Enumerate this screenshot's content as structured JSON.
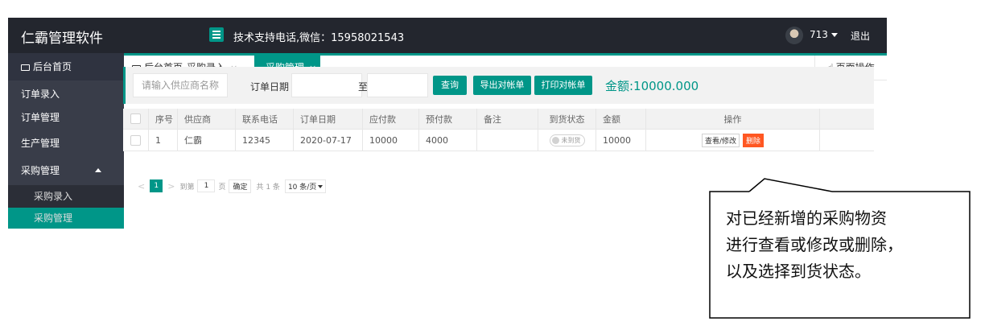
{
  "header": {
    "brand": "仁霸管理软件",
    "support": "技术支持电话,微信：15958021543",
    "user": "713",
    "logout": "退出"
  },
  "sidebar": {
    "items": [
      {
        "label": "后台首页"
      },
      {
        "label": "订单录入"
      },
      {
        "label": "订单管理"
      },
      {
        "label": "生产管理"
      },
      {
        "label": "采购管理"
      },
      {
        "label": "采购录入"
      },
      {
        "label": "采购管理"
      }
    ]
  },
  "tabs": {
    "home": "后台首页",
    "entry": "采购录入",
    "mgmt": "采购管理",
    "close": "×",
    "page_ops": "页面操作"
  },
  "filter": {
    "supplier_placeholder": "请输入供应商名称",
    "date_label": "订单日期",
    "to": "至",
    "query": "查询",
    "export": "导出对帐单",
    "print": "打印对帐单",
    "amount": "金额:10000.000"
  },
  "table": {
    "headers": [
      "序号",
      "供应商",
      "联系电话",
      "订单日期",
      "应付款",
      "预付款",
      "备注",
      "到货状态",
      "金额",
      "操作"
    ],
    "rows": [
      {
        "no": "1",
        "supplier": "仁霸",
        "phone": "12345",
        "date": "2020-07-17",
        "payable": "10000",
        "prepaid": "4000",
        "note": "",
        "arrival": "未到货",
        "amount": "10000",
        "view": "查看/修改",
        "delete": "删除"
      }
    ]
  },
  "pager": {
    "prev": "<",
    "page": "1",
    "next": ">",
    "goto": "到第",
    "goto_value": "1",
    "page_unit": "页",
    "ok": "确定",
    "total": "共 1 条",
    "size": "10 条/页"
  },
  "callout": {
    "line1": "对已经新增的采购物资",
    "line2": "进行查看或修改或删除，",
    "line3": "以及选择到货状态。"
  },
  "colors": {
    "accent": "#009688",
    "header_bg": "#23262e",
    "sidebar_bg": "#393d49",
    "danger": "#ff5722"
  }
}
